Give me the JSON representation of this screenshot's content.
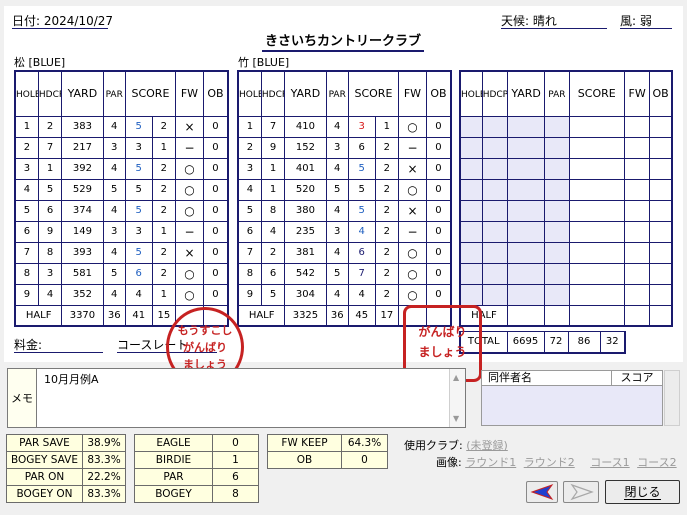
{
  "header": {
    "date": "日付: 2024/10/27",
    "weather": "天候: 晴れ",
    "wind": "風: 弱",
    "course_name": "きさいちカントリークラブ"
  },
  "columns": {
    "hole": "HOLE",
    "hdcp": "HDCP",
    "yard": "YARD",
    "par": "PAR",
    "score": "SCORE",
    "fw": "FW",
    "ob": "OB"
  },
  "front": {
    "title": "松 [BLUE]",
    "rows": [
      {
        "hole": "1",
        "hdcp": "2",
        "yard": "383",
        "par": "4",
        "score": "5",
        "putts": "2",
        "fw": "×",
        "ob": "0",
        "color": "blue"
      },
      {
        "hole": "2",
        "hdcp": "7",
        "yard": "217",
        "par": "3",
        "score": "3",
        "putts": "1",
        "fw": "−",
        "ob": "0",
        "color": "black"
      },
      {
        "hole": "3",
        "hdcp": "1",
        "yard": "392",
        "par": "4",
        "score": "5",
        "putts": "2",
        "fw": "○",
        "ob": "0",
        "color": "blue"
      },
      {
        "hole": "4",
        "hdcp": "5",
        "yard": "529",
        "par": "5",
        "score": "5",
        "putts": "2",
        "fw": "○",
        "ob": "0",
        "color": "black"
      },
      {
        "hole": "5",
        "hdcp": "6",
        "yard": "374",
        "par": "4",
        "score": "5",
        "putts": "2",
        "fw": "○",
        "ob": "0",
        "color": "blue"
      },
      {
        "hole": "6",
        "hdcp": "9",
        "yard": "149",
        "par": "3",
        "score": "3",
        "putts": "1",
        "fw": "−",
        "ob": "0",
        "color": "black"
      },
      {
        "hole": "7",
        "hdcp": "8",
        "yard": "393",
        "par": "4",
        "score": "5",
        "putts": "2",
        "fw": "×",
        "ob": "0",
        "color": "blue"
      },
      {
        "hole": "8",
        "hdcp": "3",
        "yard": "581",
        "par": "5",
        "score": "6",
        "putts": "2",
        "fw": "○",
        "ob": "0",
        "color": "blue"
      },
      {
        "hole": "9",
        "hdcp": "4",
        "yard": "352",
        "par": "4",
        "score": "4",
        "putts": "1",
        "fw": "○",
        "ob": "0",
        "color": "black"
      }
    ],
    "half": {
      "label": "HALF",
      "yard": "3370",
      "par": "36",
      "score": "41",
      "putts": "15"
    }
  },
  "back": {
    "title": "竹 [BLUE]",
    "rows": [
      {
        "hole": "1",
        "hdcp": "7",
        "yard": "410",
        "par": "4",
        "score": "3",
        "putts": "1",
        "fw": "○",
        "ob": "0",
        "color": "red"
      },
      {
        "hole": "2",
        "hdcp": "9",
        "yard": "152",
        "par": "3",
        "score": "6",
        "putts": "2",
        "fw": "−",
        "ob": "0",
        "color": "black"
      },
      {
        "hole": "3",
        "hdcp": "1",
        "yard": "401",
        "par": "4",
        "score": "5",
        "putts": "2",
        "fw": "×",
        "ob": "0",
        "color": "blue"
      },
      {
        "hole": "4",
        "hdcp": "1",
        "yard": "520",
        "par": "5",
        "score": "5",
        "putts": "2",
        "fw": "○",
        "ob": "0",
        "color": "black"
      },
      {
        "hole": "5",
        "hdcp": "8",
        "yard": "380",
        "par": "4",
        "score": "5",
        "putts": "2",
        "fw": "×",
        "ob": "0",
        "color": "blue"
      },
      {
        "hole": "6",
        "hdcp": "4",
        "yard": "235",
        "par": "3",
        "score": "4",
        "putts": "2",
        "fw": "−",
        "ob": "0",
        "color": "blue"
      },
      {
        "hole": "7",
        "hdcp": "2",
        "yard": "381",
        "par": "4",
        "score": "6",
        "putts": "2",
        "fw": "○",
        "ob": "0",
        "color": "navy"
      },
      {
        "hole": "8",
        "hdcp": "6",
        "yard": "542",
        "par": "5",
        "score": "7",
        "putts": "2",
        "fw": "○",
        "ob": "0",
        "color": "navy"
      },
      {
        "hole": "9",
        "hdcp": "5",
        "yard": "304",
        "par": "4",
        "score": "4",
        "putts": "2",
        "fw": "○",
        "ob": "0",
        "color": "black"
      }
    ],
    "half": {
      "label": "HALF",
      "yard": "3325",
      "par": "36",
      "score": "45",
      "putts": "17"
    }
  },
  "third": {
    "half_label": "HALF"
  },
  "total": {
    "label": "TOTAL",
    "yard": "6695",
    "par": "72",
    "score": "86",
    "putts": "32"
  },
  "fee": {
    "label": "料金:",
    "course_rate": "コースレート"
  },
  "memo": {
    "label": "メモ",
    "text": "10月月例A"
  },
  "companions": {
    "name_header": "同伴者名",
    "score_header": "スコア"
  },
  "stats_left": [
    {
      "label": "PAR SAVE",
      "value": "38.9%"
    },
    {
      "label": "BOGEY SAVE",
      "value": "83.3%"
    },
    {
      "label": "PAR ON",
      "value": "22.2%"
    },
    {
      "label": "BOGEY ON",
      "value": "83.3%"
    }
  ],
  "stats_mid": [
    {
      "label": "EAGLE",
      "value": "0"
    },
    {
      "label": "BIRDIE",
      "value": "1"
    },
    {
      "label": "PAR",
      "value": "6"
    },
    {
      "label": "BOGEY",
      "value": "8"
    }
  ],
  "stats_right": [
    {
      "label": "FW KEEP",
      "value": "64.3%"
    },
    {
      "label": "OB",
      "value": "0"
    }
  ],
  "club": {
    "label": "使用クラブ:",
    "value": "(未登録)"
  },
  "images": {
    "label": "画像:",
    "links": [
      "ラウンド1",
      "ラウンド2",
      "コース1",
      "コース2"
    ]
  },
  "stamps": {
    "left": [
      "もうすこし",
      "がんばり",
      "ましょう"
    ],
    "right": [
      "がんばり",
      "ましょう"
    ]
  },
  "buttons": {
    "close": "閉じる"
  },
  "colors": {
    "frame": "#1a1a6e",
    "birdie": "#d81b1b",
    "bogey": "#1f5fc0",
    "stamp": "#c62222",
    "stats_bg": "#ffffe0"
  }
}
